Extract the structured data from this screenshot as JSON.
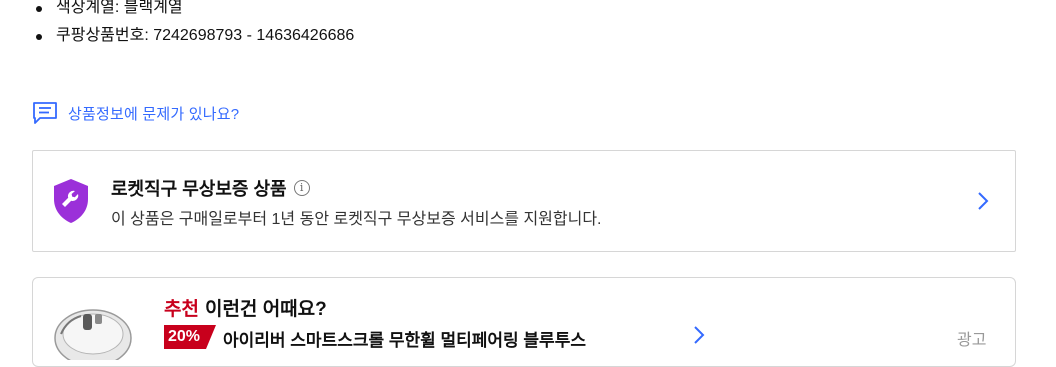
{
  "specs": [
    "색상계열: 블랙계열",
    "쿠팡상품번호: 7242698793 - 14636426686"
  ],
  "report": {
    "label": "상품정보에 문제가 있나요?"
  },
  "warranty": {
    "title": "로켓직구 무상보증 상품",
    "info_glyph": "i",
    "description": "이 상품은 구매일로부터 1년 동안 로켓직구 무상보증 서비스를 지원합니다."
  },
  "recommend": {
    "highlight": "추천",
    "title": "이런건 어때요?",
    "discount": "20%",
    "product_name": "아이리버 스마트스크롤 무한휠 멀티페어링 블루투스",
    "ad_label": "광고"
  },
  "colors": {
    "link": "#346aff",
    "accent": "#c8001c",
    "shield": "#9b30d9"
  },
  "icons": [
    "chat-report-icon",
    "wrench-shield-icon",
    "info-icon",
    "chevron-right-icon",
    "mouse-product-image"
  ]
}
